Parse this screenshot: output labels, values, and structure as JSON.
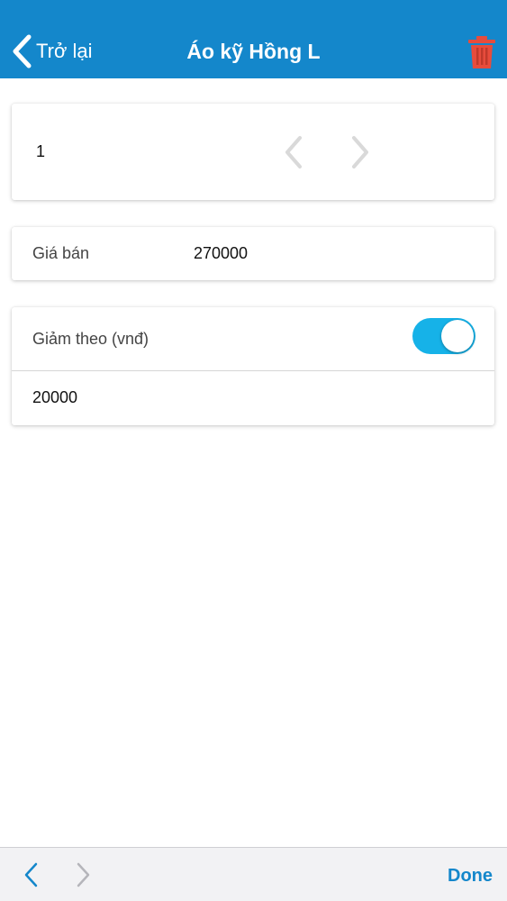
{
  "header": {
    "back_label": "Trở lại",
    "title": "Áo kỹ Hồng L",
    "background_color": "#1487cb",
    "trash_color": "#e74c3c"
  },
  "quantity": {
    "value": "1",
    "prev_icon": "chevron-left-icon",
    "next_icon": "chevron-right-icon"
  },
  "price": {
    "label": "Giá bán",
    "value": "270000"
  },
  "discount": {
    "label": "Giảm theo (vnđ)",
    "toggle_on": true,
    "toggle_color": "#16b2e8",
    "value": "20000"
  },
  "keyboard_bar": {
    "done_label": "Done",
    "accent_color": "#1487cb"
  }
}
